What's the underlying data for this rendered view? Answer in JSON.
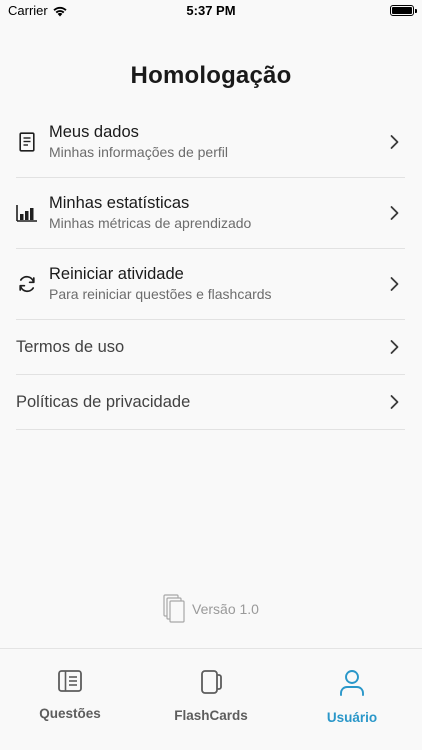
{
  "status_bar": {
    "carrier": "Carrier",
    "time": "5:37 PM"
  },
  "title": "Homologação",
  "menu": {
    "items": [
      {
        "title": "Meus dados",
        "subtitle": "Minhas informações de perfil",
        "icon": "document-icon"
      },
      {
        "title": "Minhas estatísticas",
        "subtitle": "Minhas métricas de aprendizado",
        "icon": "bar-chart-icon"
      },
      {
        "title": "Reiniciar atividade",
        "subtitle": "Para reiniciar questões e flashcards",
        "icon": "refresh-icon"
      }
    ],
    "links": [
      {
        "title": "Termos de uso"
      },
      {
        "title": "Políticas de privacidade"
      }
    ]
  },
  "version": {
    "label": "Versão 1.0",
    "icon": "copy-stack-icon"
  },
  "tab_bar": {
    "tabs": [
      {
        "label": "Questões",
        "icon": "list-icon",
        "active": false
      },
      {
        "label": "FlashCards",
        "icon": "cards-icon",
        "active": false
      },
      {
        "label": "Usuário",
        "icon": "user-icon",
        "active": true
      }
    ],
    "active_color": "#2a97c9",
    "inactive_color": "#5d5d5d"
  }
}
